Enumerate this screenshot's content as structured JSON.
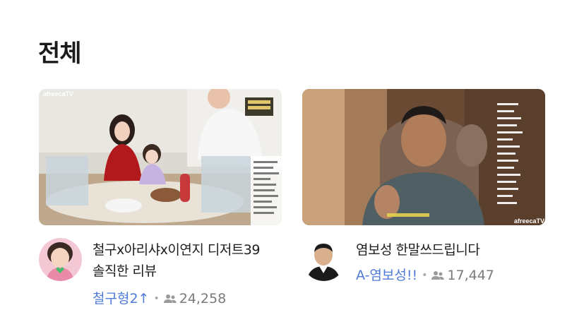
{
  "section": {
    "title": "전체"
  },
  "cards": [
    {
      "title": "철구x아리샤x이연지 디저트39 솔직한 리뷰",
      "streamer": "철구형2↑",
      "viewers": "24,258",
      "thumb_logo": "afreecaTV"
    },
    {
      "title": "염보성 한말쓰드립니다",
      "streamer": "A-염보성!!",
      "viewers": "17,447",
      "thumb_logo": "afreecaTV"
    }
  ],
  "colors": {
    "streamer": "#4f7bd8",
    "viewers": "#7a7a7a"
  },
  "icons": {
    "viewers": "users-icon"
  }
}
